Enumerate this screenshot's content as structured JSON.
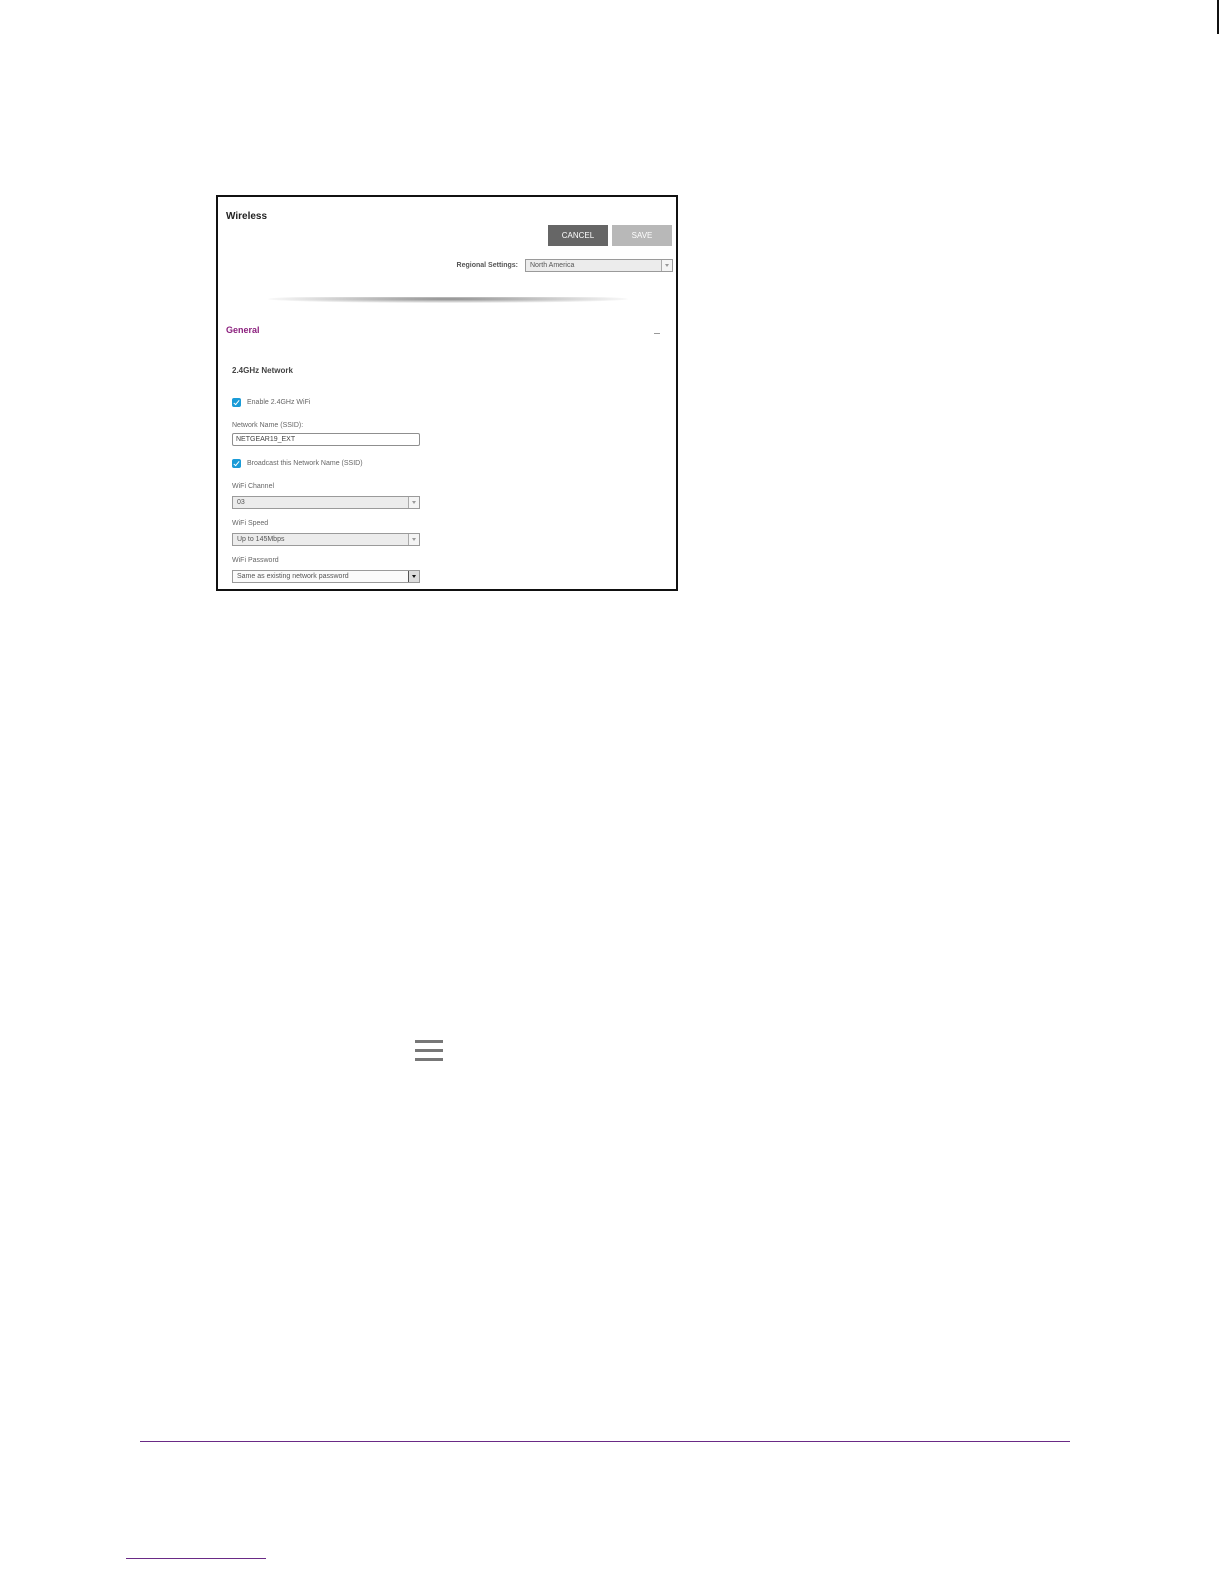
{
  "window": {
    "title": "Wireless"
  },
  "toolbar": {
    "cancel_label": "CANCEL",
    "save_label": "SAVE"
  },
  "regional": {
    "label": "Regional Settings:",
    "value": "North America"
  },
  "general": {
    "title": "General",
    "network_title": "2.4GHz Network",
    "enable_wifi": {
      "label": "Enable 2.4GHz WiFi",
      "checked": true
    },
    "ssid": {
      "label": "Network Name (SSID):",
      "value": "NETGEAR19_EXT"
    },
    "broadcast": {
      "label": "Broadcast this Network Name (SSID)",
      "checked": true
    },
    "channel": {
      "label": "WiFi Channel",
      "value": "03"
    },
    "speed": {
      "label": "WiFi Speed",
      "value": "Up to 145Mbps"
    },
    "password": {
      "label": "WiFi Password",
      "value": "Same as existing network password"
    }
  },
  "icons": {
    "collapse": "minus-icon",
    "menu": "hamburger-menu-icon",
    "checkbox": "checkmark-icon"
  },
  "colors": {
    "section_title": "#8b1f7d",
    "checkbox": "#1a9bd7",
    "cancel_button": "#666666",
    "save_button": "#b8b8b8",
    "footer_rule": "#6a2a86"
  }
}
